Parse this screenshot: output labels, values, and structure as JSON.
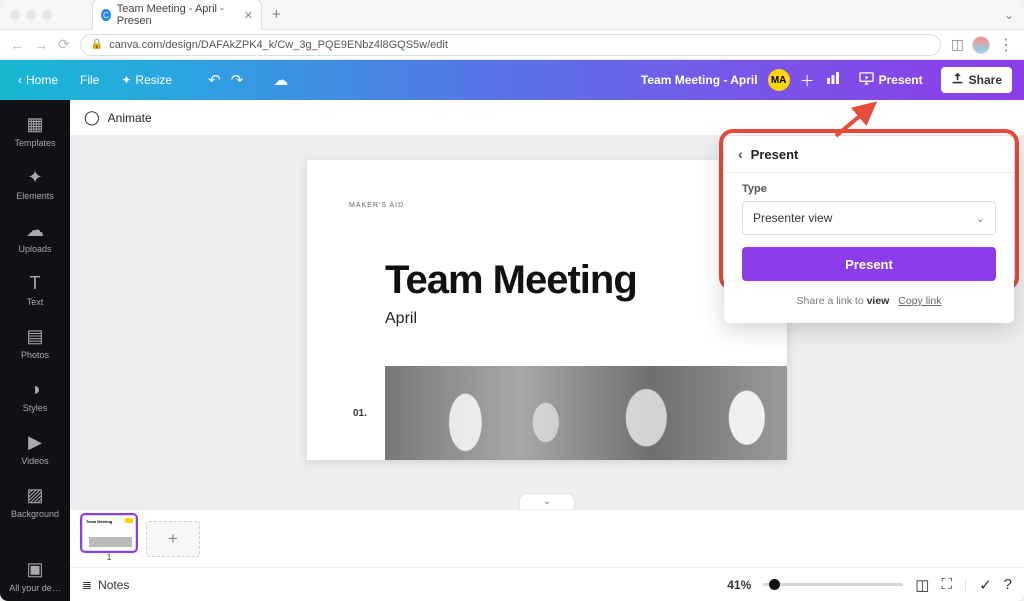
{
  "browser": {
    "tab_title": "Team Meeting - April - Presen",
    "url": "canva.com/design/DAFAkZPK4_k/Cw_3g_PQE9ENbz4l8GQS5w/edit"
  },
  "header": {
    "home": "Home",
    "file": "File",
    "resize": "Resize",
    "doc_title": "Team Meeting - April",
    "user_initials": "MA",
    "present": "Present",
    "share": "Share"
  },
  "left_rail": [
    {
      "icon": "▦",
      "label": "Templates"
    },
    {
      "icon": "✦",
      "label": "Elements"
    },
    {
      "icon": "☁",
      "label": "Uploads"
    },
    {
      "icon": "T",
      "label": "Text"
    },
    {
      "icon": "▤",
      "label": "Photos"
    },
    {
      "icon": "◑",
      "label": "Styles"
    },
    {
      "icon": "▶",
      "label": "Videos"
    },
    {
      "icon": "▨",
      "label": "Background"
    },
    {
      "icon": "▣",
      "label": "All your de…"
    }
  ],
  "toolbar": {
    "animate": "Animate"
  },
  "slide": {
    "eyebrow": "MAKER'S AID",
    "title": "Team Meeting",
    "subtitle": "April",
    "page_number": "01."
  },
  "thumbnails": {
    "page1_label": "1",
    "page1_title": "Team Meeting"
  },
  "footer": {
    "notes": "Notes",
    "zoom": "41%"
  },
  "popover": {
    "header": "Present",
    "type_label": "Type",
    "selected_type": "Presenter view",
    "primary_button": "Present",
    "footer_pre": "Share a link to ",
    "footer_bold": "view",
    "copy_link": "Copy link"
  }
}
